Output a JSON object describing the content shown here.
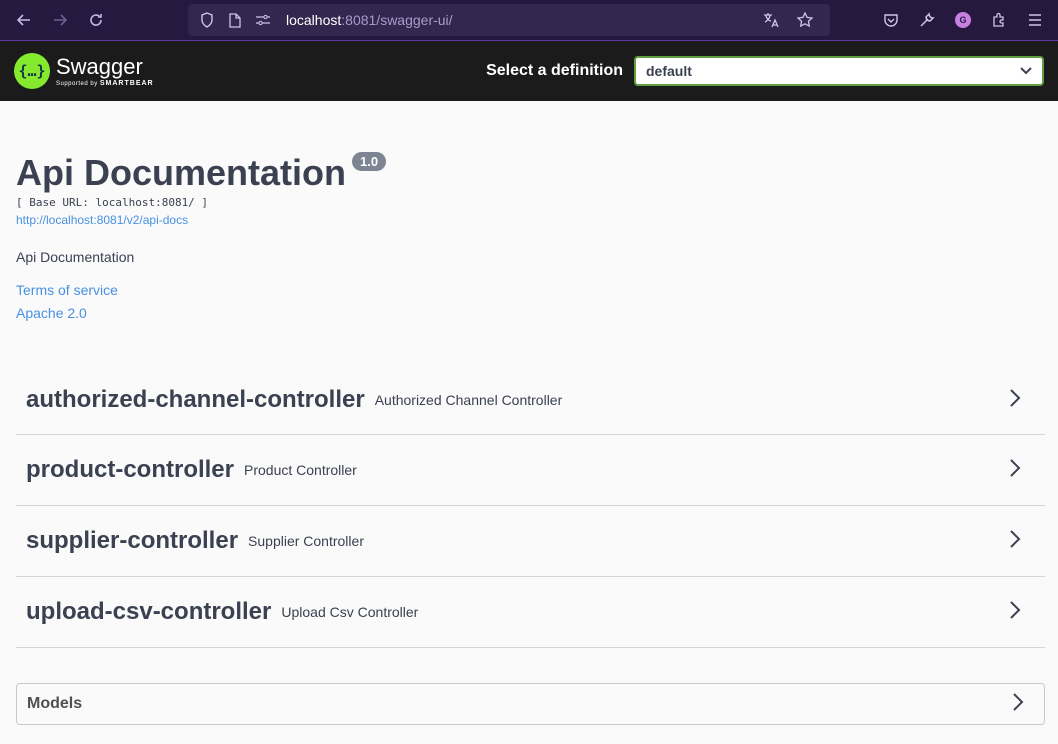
{
  "browser": {
    "url_host": "localhost",
    "url_rest": ":8081/swagger-ui/",
    "avatar_letter": "G"
  },
  "topbar": {
    "logo_name": "Swagger",
    "logo_sub_prefix": "Supported by",
    "logo_sub_brand": "SMARTBEAR",
    "logo_glyph": "{…}",
    "definition_label": "Select a definition",
    "definition_value": "default"
  },
  "info": {
    "title": "Api Documentation",
    "version": "1.0",
    "base_url": "[ Base URL: localhost:8081/ ]",
    "docs_link": "http://localhost:8081/v2/api-docs",
    "description": "Api Documentation",
    "terms_link": "Terms of service",
    "license_link": "Apache 2.0"
  },
  "tags": [
    {
      "name": "authorized-channel-controller",
      "description": "Authorized Channel Controller"
    },
    {
      "name": "product-controller",
      "description": "Product Controller"
    },
    {
      "name": "supplier-controller",
      "description": "Supplier Controller"
    },
    {
      "name": "upload-csv-controller",
      "description": "Upload Csv Controller"
    }
  ],
  "models": {
    "title": "Models"
  },
  "colors": {
    "swagger_green": "#85ea2d",
    "link_blue": "#4990e2",
    "topbar_bg": "#1b1b1b",
    "browser_bg": "#25193f"
  }
}
